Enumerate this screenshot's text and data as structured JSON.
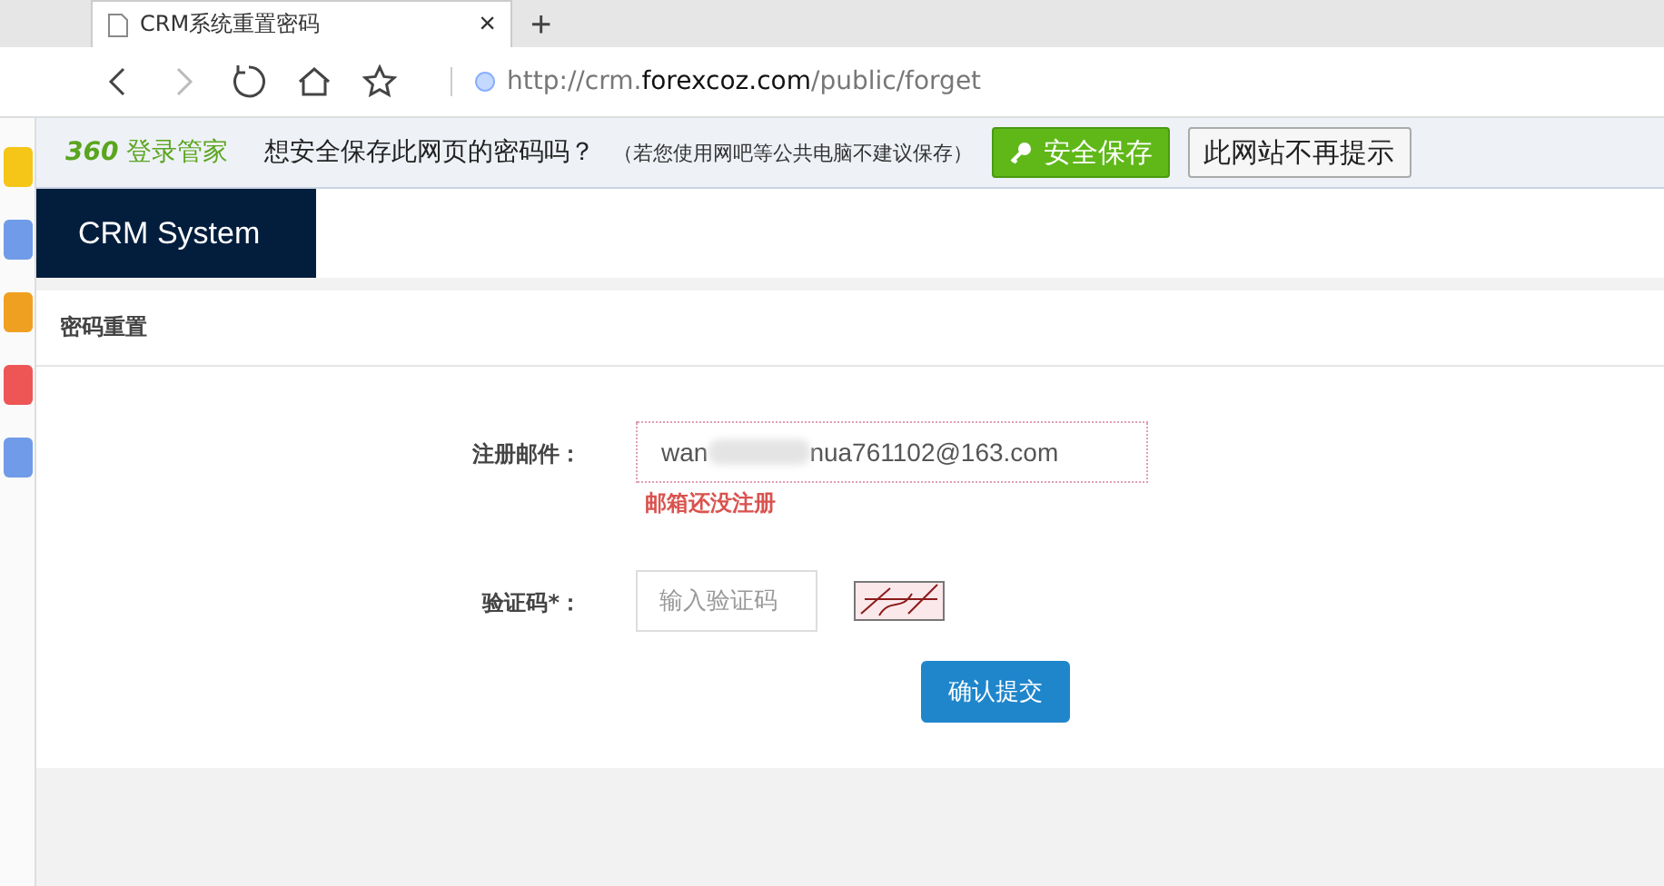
{
  "browser": {
    "tab_title": "CRM系统重置密码",
    "tab_close": "×",
    "new_tab": "+",
    "url": {
      "scheme_host": "http://crm.",
      "domain": "forexcoz.com",
      "path": "/public/forget"
    }
  },
  "password_bar": {
    "brand_mark": "360",
    "brand": "登录管家",
    "question": "想安全保存此网页的密码吗？",
    "note": "（若您使用网吧等公共电脑不建议保存）",
    "buttons": [
      {
        "label": "安全保存",
        "kind": "primary"
      },
      {
        "label": "此网站不再提示",
        "kind": "plain"
      }
    ]
  },
  "header": {
    "title": "CRM System"
  },
  "panel": {
    "title": "密码重置"
  },
  "form": {
    "email": {
      "label": "注册邮件：",
      "value_start": "wan",
      "value_end": "nua761102@163.com",
      "error": "邮箱还没注册"
    },
    "captcha": {
      "label": "验证码*：",
      "placeholder": "输入验证码"
    },
    "submit": "确认提交"
  }
}
